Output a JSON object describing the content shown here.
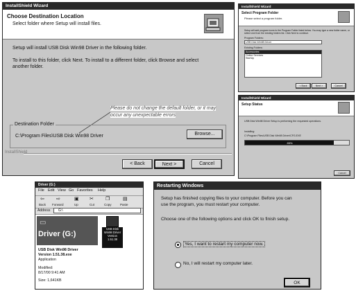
{
  "w1": {
    "title": "InstallShield Wizard",
    "heading": "Choose Destination Location",
    "subheading": "Select folder where Setup will install files.",
    "body1": "Setup will install USB Disk Win98 Driver in the following folder.",
    "body2a": "To install to this folder, click Next. To install to a different folder, click Browse and select",
    "body2b": "another folder.",
    "note1": "Please do not change the default folder, or it may",
    "note2": "occur any unexpectable errors",
    "group_label": "Destination Folder",
    "path": "C:\\Program Files\\USB Disk Win98 Driver",
    "browse": "Browse...",
    "footer": "InstallShield",
    "back": "< Back",
    "next": "Next >",
    "cancel": "Cancel"
  },
  "w2": {
    "title": "InstallShield Wizard",
    "heading": "Select Program Folder",
    "subheading": "Please select a program folder.",
    "body": "Setup will add program icons to the Program Folder listed below. You may type a new folder name, or select one from the existing folders list. Click Next to continue.",
    "field_label": "Program Folders:",
    "field_value": "USB Disk Win98 Driver",
    "list_label": "Existing Folders:",
    "items": [
      "Accessories",
      "Online Services",
      "StartUp"
    ],
    "back": "< Back",
    "next": "Next >",
    "cancel": "Cancel"
  },
  "w3": {
    "title": "InstallShield Wizard",
    "heading": "Setup Status",
    "body": "USB Disk Win98 Driver Setup is performing the requested operations.",
    "installing": "Installing:",
    "file": "C:\\Program Files\\USB Disk Win98 Driver\\CFG.EXE",
    "percent": "85%",
    "progress": 0.85,
    "cancel": "Cancel"
  },
  "w4": {
    "title": "Driver (G:)",
    "menu": [
      "File",
      "Edit",
      "View",
      "Go",
      "Favorites",
      "Help"
    ],
    "toolbar": [
      "Back",
      "Forward",
      "Up",
      "Cut",
      "Copy",
      "Paste"
    ],
    "address_label": "Address",
    "address_value": "G:\\",
    "drive_label": "Driver (G:)",
    "info_title": "USB Disk Win98 Driver",
    "info_version": "Version 1.51.38.exe",
    "info_type": "Application",
    "modified_label": "Modified:",
    "modified_value": "8/17/00 9:41 AM",
    "size": "Size: 1,641KB",
    "file_label_1": "USB Disk",
    "file_label_2": "Win98 Driver",
    "file_label_3": "Version",
    "file_label_4": "1.51.38"
  },
  "w5": {
    "title": "Restarting Windows",
    "p1a": "Setup has finished copying files to your computer.  Before you can",
    "p1b": "use the program, you must restart your computer.",
    "p2": "Choose one of the following options and click OK to finish setup.",
    "opt1": "Yes, I want to restart my computer now.",
    "opt2": "No, I will restart my computer later.",
    "ok": "OK",
    "selected_option": 1
  }
}
